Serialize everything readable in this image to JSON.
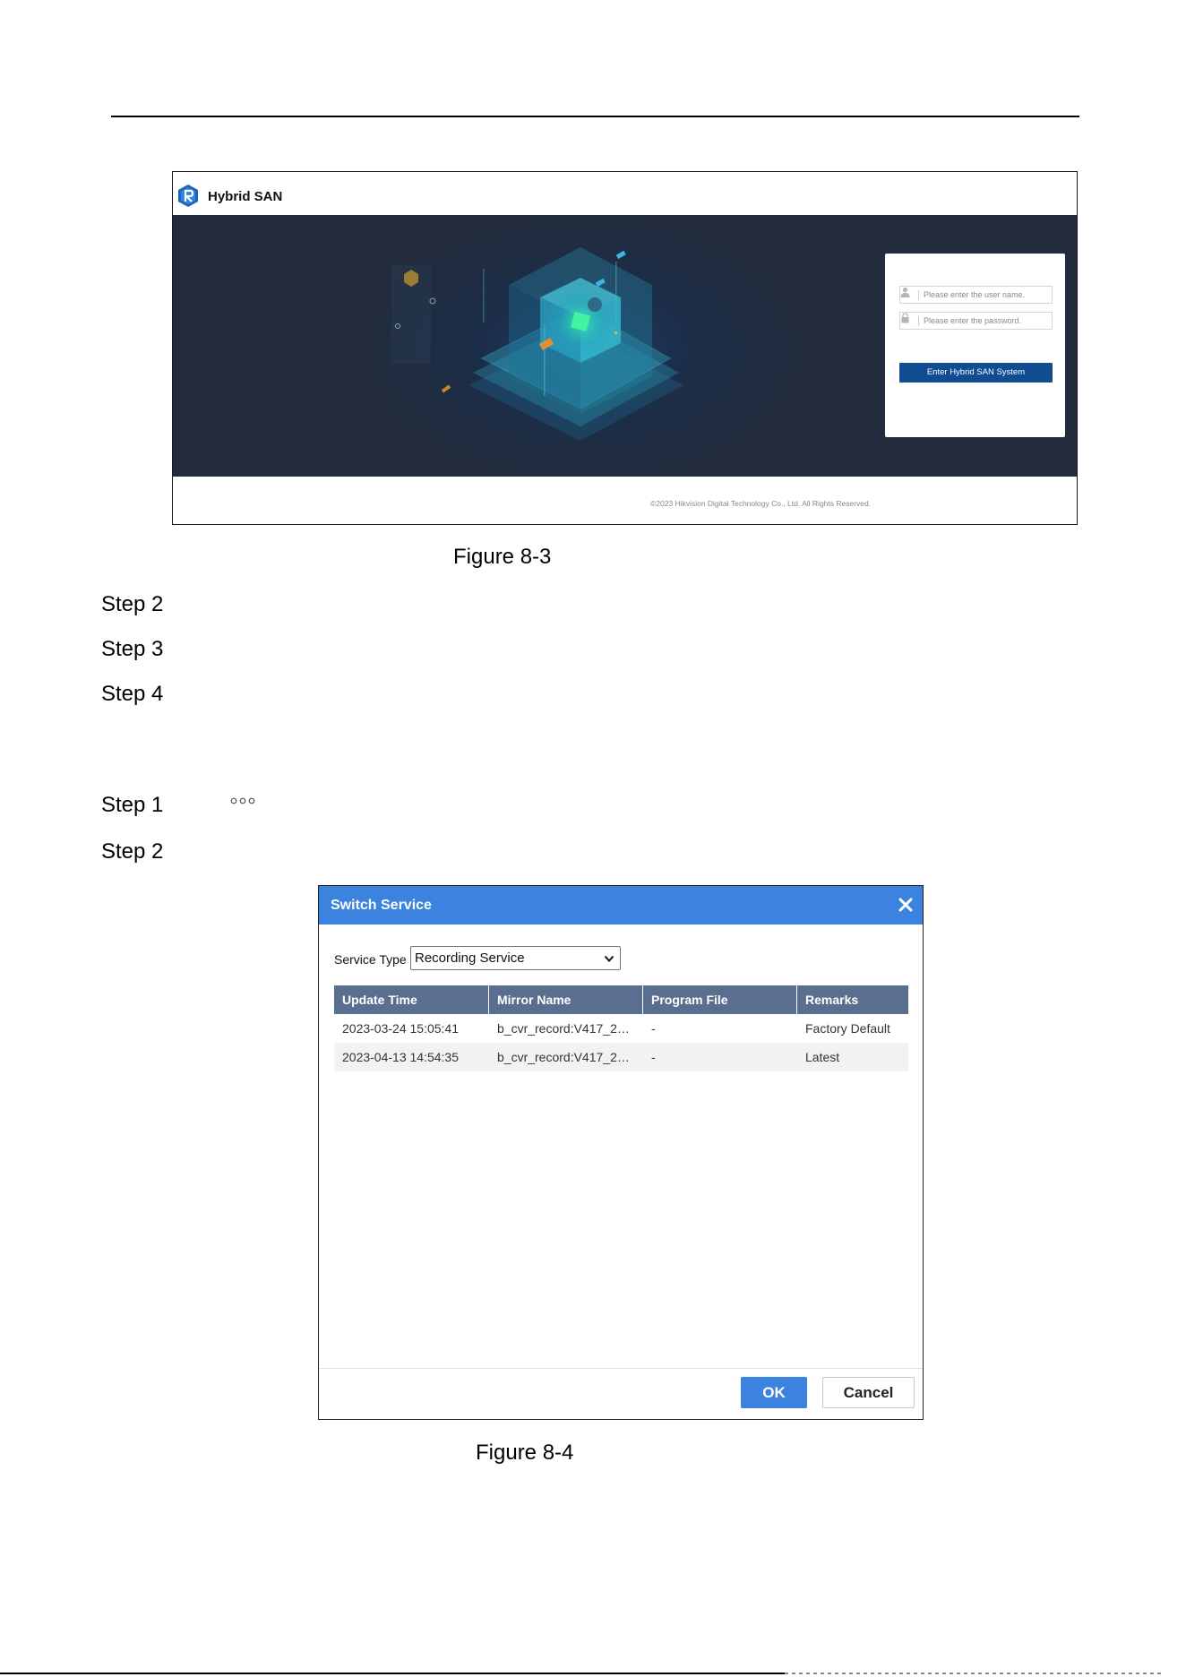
{
  "figure_8_3": {
    "product_name": "Hybrid SAN",
    "login": {
      "username_placeholder": "Please enter the user name.",
      "password_placeholder": "Please enter the password.",
      "submit_label": "Enter Hybrid SAN System"
    },
    "copyright": "©2023 Hikvision Digital Technology Co., Ltd. All Rights Reserved.",
    "caption": "Figure 8-3"
  },
  "steps_a": [
    "Step 2",
    "Step 3",
    "Step 4"
  ],
  "steps_b": {
    "step1": "Step 1",
    "step1_icon": "more-icon",
    "step2": "Step 2"
  },
  "figure_8_4": {
    "dialog_title": "Switch Service",
    "service_type_label": "Service Type",
    "service_type_value": "Recording Service",
    "columns": [
      "Update Time",
      "Mirror Name",
      "Program File",
      "Remarks"
    ],
    "rows": [
      [
        "2023-03-24 15:05:41",
        "b_cvr_record:V417_2…",
        "-",
        "Factory Default"
      ],
      [
        "2023-04-13 14:54:35",
        "b_cvr_record:V417_2…",
        "-",
        "Latest"
      ]
    ],
    "ok_label": "OK",
    "cancel_label": "Cancel",
    "caption": "Figure 8-4",
    "colors": {
      "title_bar": "#3c82df",
      "table_header": "#5a6f8f",
      "row_alt": "#f2f2f2"
    }
  }
}
